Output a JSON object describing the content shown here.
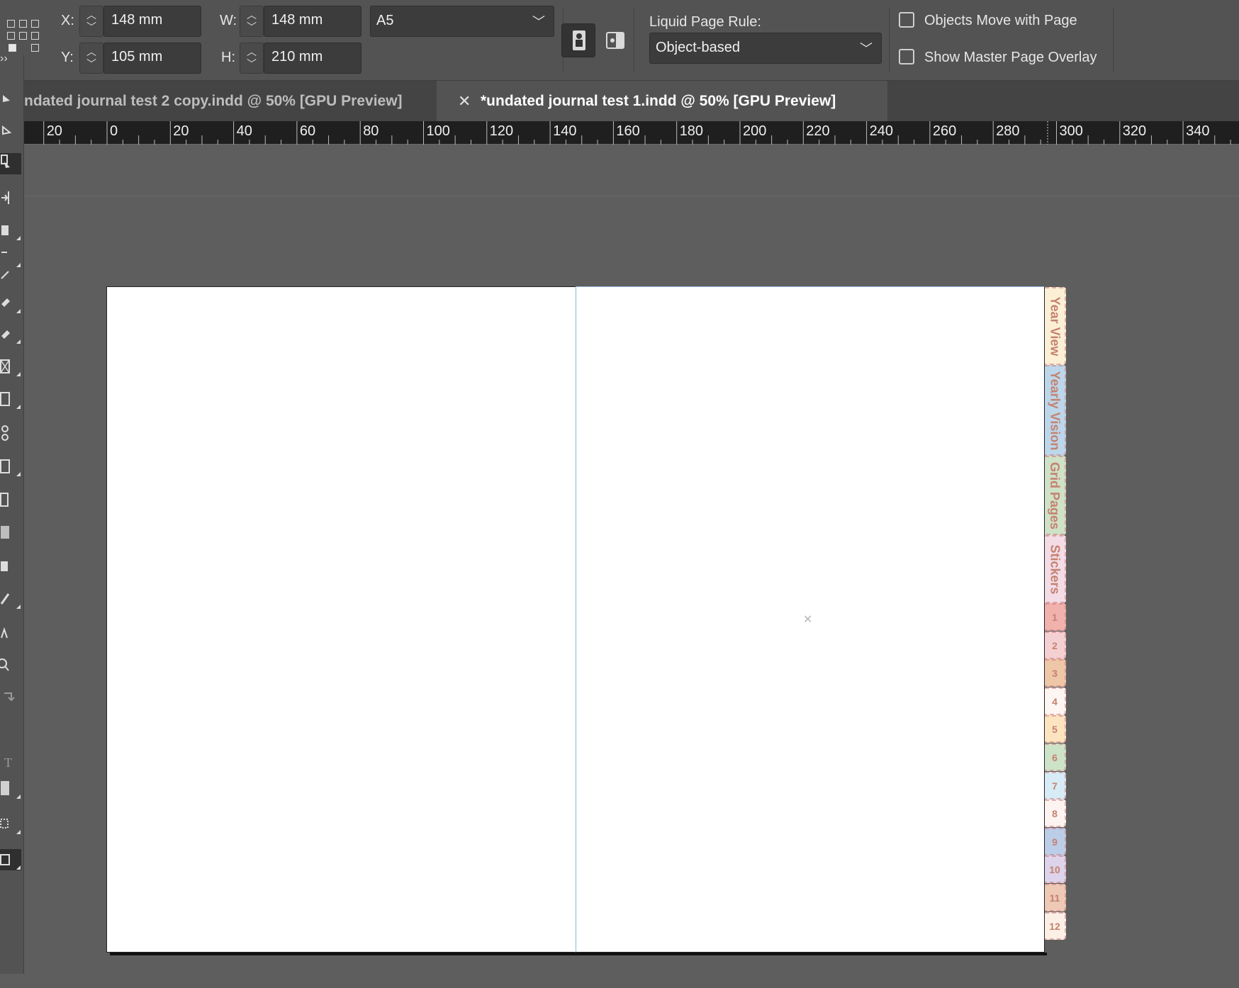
{
  "control": {
    "x_label": "X:",
    "y_label": "Y:",
    "w_label": "W:",
    "h_label": "H:",
    "x_value": "148 mm",
    "y_value": "105 mm",
    "w_value": "148 mm",
    "h_value": "210 mm",
    "page_size": "A5",
    "liquid_label": "Liquid Page Rule:",
    "liquid_value": "Object-based",
    "objects_move_label": "Objects Move with Page",
    "objects_move_checked": false,
    "show_master_label": "Show Master Page Overlay",
    "show_master_checked": false
  },
  "tabs": [
    {
      "label": "ndated journal test 2 copy.indd @ 50% [GPU Preview]",
      "active": false
    },
    {
      "label": "*undated journal test 1.indd @ 50% [GPU Preview]",
      "active": true,
      "close": "✕"
    }
  ],
  "ruler": {
    "labels": [
      "20",
      "0",
      "20",
      "40",
      "60",
      "80",
      "100",
      "120",
      "140",
      "160",
      "180",
      "200",
      "220",
      "240",
      "260",
      "280",
      "300",
      "320",
      "340"
    ]
  },
  "side_tabs": [
    {
      "label": "Year View",
      "bg": "#fbf0d6",
      "color": "#c4826f"
    },
    {
      "label": "Yearly Vision",
      "bg": "#bcd6ea",
      "color": "#c4826f"
    },
    {
      "label": "Grid Pages",
      "bg": "#cfe1c6",
      "color": "#c4826f"
    },
    {
      "label": "Stickers",
      "bg": "#f3dce6",
      "color": "#c4826f"
    }
  ],
  "month_tabs": [
    {
      "label": "1",
      "bg": "#f1b1ad",
      "color": "#c4826f"
    },
    {
      "label": "2",
      "bg": "#f5d0d3",
      "color": "#c4826f"
    },
    {
      "label": "3",
      "bg": "#eec6a8",
      "color": "#c4826f"
    },
    {
      "label": "4",
      "bg": "#fdf6f2",
      "color": "#c4826f"
    },
    {
      "label": "5",
      "bg": "#fce4c0",
      "color": "#c4826f"
    },
    {
      "label": "6",
      "bg": "#cde3c7",
      "color": "#c4826f"
    },
    {
      "label": "7",
      "bg": "#d7ecf6",
      "color": "#c4826f"
    },
    {
      "label": "8",
      "bg": "#fdf3f0",
      "color": "#c4826f"
    },
    {
      "label": "9",
      "bg": "#bccde8",
      "color": "#c4826f"
    },
    {
      "label": "10",
      "bg": "#ddd3ea",
      "color": "#c4826f"
    },
    {
      "label": "11",
      "bg": "#edc9b6",
      "color": "#c4826f"
    },
    {
      "label": "12",
      "bg": "#fcf0e6",
      "color": "#c4826f"
    }
  ]
}
